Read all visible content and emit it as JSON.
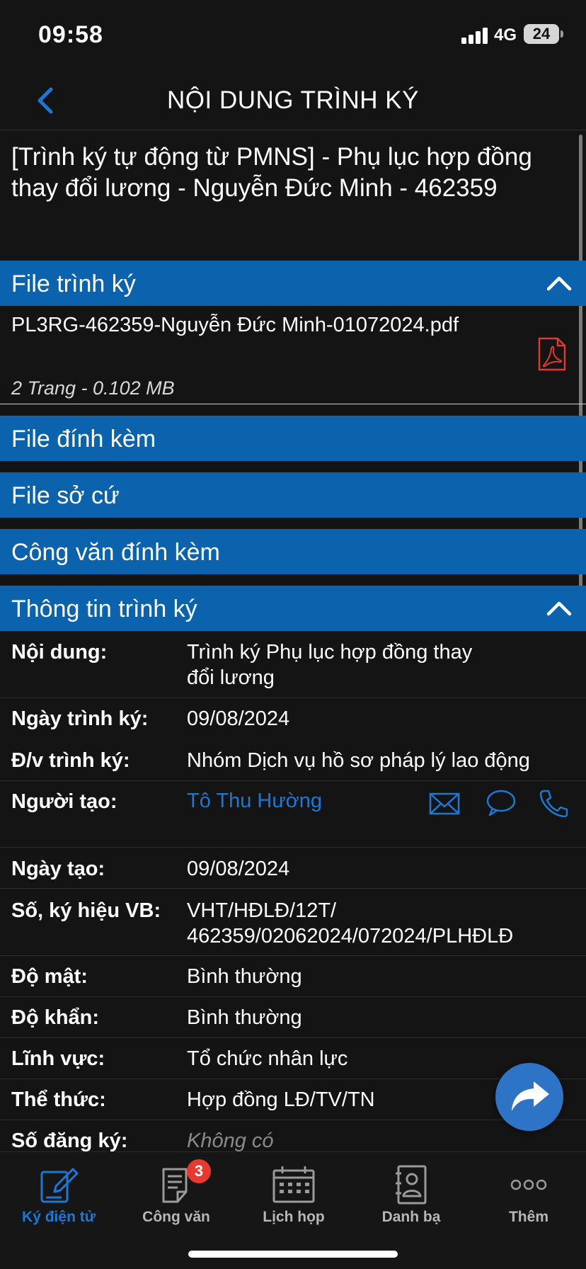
{
  "status_bar": {
    "time": "09:58",
    "network": "4G",
    "battery": "24"
  },
  "header": {
    "title": "NỘI DUNG TRÌNH KÝ"
  },
  "document": {
    "title_line1": "[Trình ký tự động từ PMNS] - Phụ lục hợp đồng",
    "title_line2": "thay đổi lương - Nguyễn Đức Minh - 462359"
  },
  "sections": {
    "file_trinh_ky": "File trình ký",
    "file_dinh_kem": "File đính kèm",
    "file_so_cu": "File sở cứ",
    "cong_van_dinh_kem": "Công văn đính kèm",
    "thong_tin_trinh_ky": "Thông tin trình ký"
  },
  "file": {
    "name": "PL3RG-462359-Nguyễn Đức Minh-01072024.pdf",
    "meta": "2 Trang - 0.102 MB"
  },
  "info": {
    "noi_dung": {
      "label": "Nội dung:",
      "value_line1": "Trình ký Phụ lục hợp đồng thay",
      "value_line2": "đổi lương"
    },
    "ngay_trinh_ky": {
      "label": "Ngày trình ký:",
      "value": "09/08/2024"
    },
    "dv_trinh_ky": {
      "label": "Đ/v trình ký:",
      "value": "Nhóm Dịch vụ hồ sơ pháp lý lao động"
    },
    "nguoi_tao": {
      "label": "Người tạo:",
      "value": "Tô Thu Hường"
    },
    "ngay_tao": {
      "label": "Ngày tạo:",
      "value": "09/08/2024"
    },
    "so_ky_hieu": {
      "label": "Số, ký hiệu VB:",
      "value_line1": "VHT/HĐLĐ/12T/",
      "value_line2": "462359/02062024/072024/PLHĐLĐ"
    },
    "do_mat": {
      "label": "Độ mật:",
      "value": "Bình thường"
    },
    "do_khan": {
      "label": "Độ khẩn:",
      "value": "Bình thường"
    },
    "linh_vuc": {
      "label": "Lĩnh vực:",
      "value": "Tổ chức nhân lực"
    },
    "the_thuc": {
      "label": "Thể thức:",
      "value": "Hợp đồng LĐ/TV/TN"
    },
    "so_dang_ky": {
      "label": "Số đăng ký:",
      "value": "Không có"
    }
  },
  "tabs": [
    {
      "label": "Ký điện tử",
      "icon": "sign-edit-icon",
      "active": true
    },
    {
      "label": "Công văn",
      "icon": "document-icon",
      "badge": "3"
    },
    {
      "label": "Lịch họp",
      "icon": "calendar-icon"
    },
    {
      "label": "Danh bạ",
      "icon": "contacts-icon"
    },
    {
      "label": "Thêm",
      "icon": "more-icon"
    }
  ],
  "colors": {
    "accent": "#0b63ad",
    "link": "#1a78d6",
    "badge": "#e8382f",
    "pdf": "#e0392e"
  }
}
